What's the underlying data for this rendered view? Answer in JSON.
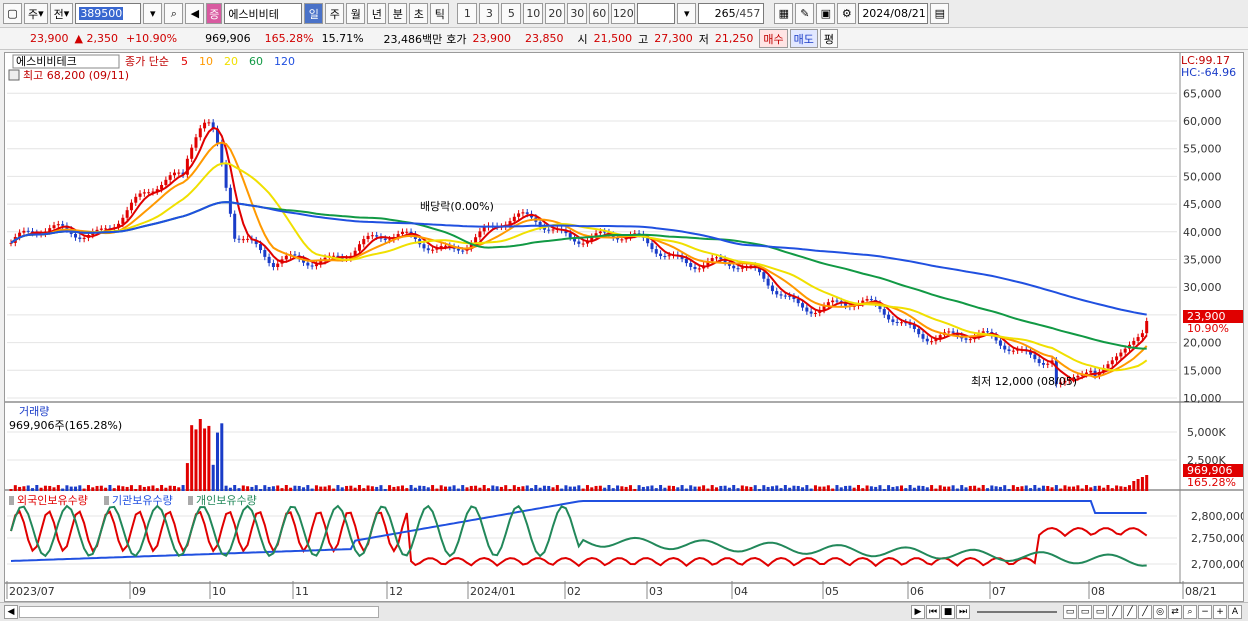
{
  "toolbar": {
    "market": "주",
    "prev": "전",
    "code": "389500",
    "badge": "증",
    "stock_name": "에스비비테",
    "periods": [
      "일",
      "주",
      "월",
      "년",
      "분",
      "초",
      "틱"
    ],
    "active_period": "일",
    "intervals": [
      "1",
      "3",
      "5",
      "10",
      "20",
      "30",
      "60",
      "120"
    ],
    "count": "265",
    "count_total": "/457",
    "date": "2024/08/21"
  },
  "info": {
    "price": "23,900",
    "change": "▲ 2,350",
    "change_pct": "+10.90%",
    "volume": "969,906",
    "volume_ratio": "165.28%",
    "turnover": "15.71%",
    "amount": "23,486백만",
    "ask_label": "호가",
    "ask": "23,900",
    "bid": "23,850",
    "open_label": "시",
    "open": "21,500",
    "high_label": "고",
    "high": "27,300",
    "low_label": "저",
    "low": "21,250",
    "buy_btn": "매수",
    "sell_btn": "매도",
    "eval_btn": "평"
  },
  "price_panel": {
    "legend_name": "에스비비테크",
    "legend_ma_title": "종가 단순",
    "ma_labels": [
      "5",
      "10",
      "20",
      "60",
      "120"
    ],
    "ma_colors": [
      "#e00000",
      "#ff9900",
      "#f0e000",
      "#119944",
      "#2050e0"
    ],
    "high_note": "최고 68,200 (09/11)",
    "low_note": "최저 12,000 (08/05)",
    "dividend_note": "배당락(0.00%)",
    "lc": "LC:99.17",
    "hc": "HC:-64.96",
    "price_tag": "23,900",
    "pct_tag": "10.90%",
    "y_ticks": [
      "65,000",
      "60,000",
      "55,000",
      "50,000",
      "45,000",
      "40,000",
      "35,000",
      "30,000",
      "25,000",
      "20,000",
      "15,000",
      "10,000"
    ]
  },
  "volume_panel": {
    "title": "거래량",
    "value_note": "969,906주(165.28%)",
    "y_ticks": [
      "5,000K",
      "2,500K"
    ],
    "tag": "969,906",
    "tag_pct": "165.28%"
  },
  "holding_panel": {
    "legends": [
      "외국인보유수량",
      "기관보유수량",
      "개인보유수량"
    ],
    "y_ticks": [
      "2,800,000",
      "2,750,000",
      "2,700,000"
    ]
  },
  "x_axis": [
    "2023/07",
    "09",
    "10",
    "11",
    "12",
    "2024/01",
    "02",
    "03",
    "04",
    "05",
    "06",
    "07",
    "08",
    "08/21"
  ],
  "chart_data": {
    "type": "candlestick",
    "title": "에스비비테크",
    "ylim": [
      10000,
      68000
    ],
    "monthly_close": [
      {
        "month": "2023/07",
        "close": 38000
      },
      {
        "month": "2023/08",
        "close": 41000
      },
      {
        "month": "2023/09",
        "close": 50000
      },
      {
        "month": "2023/10",
        "close": 33000
      },
      {
        "month": "2023/11",
        "close": 38000
      },
      {
        "month": "2023/12",
        "close": 38000
      },
      {
        "month": "2024/01",
        "close": 42000
      },
      {
        "month": "2024/02",
        "close": 38000
      },
      {
        "month": "2024/03",
        "close": 35000
      },
      {
        "month": "2024/04",
        "close": 28000
      },
      {
        "month": "2024/05",
        "close": 25000
      },
      {
        "month": "2024/06",
        "close": 20000
      },
      {
        "month": "2024/07",
        "close": 18000
      },
      {
        "month": "2024/08",
        "close": 23900
      }
    ],
    "high": {
      "value": 68200,
      "date": "09/11"
    },
    "low": {
      "value": 12000,
      "date": "08/05"
    },
    "last": 23900
  }
}
